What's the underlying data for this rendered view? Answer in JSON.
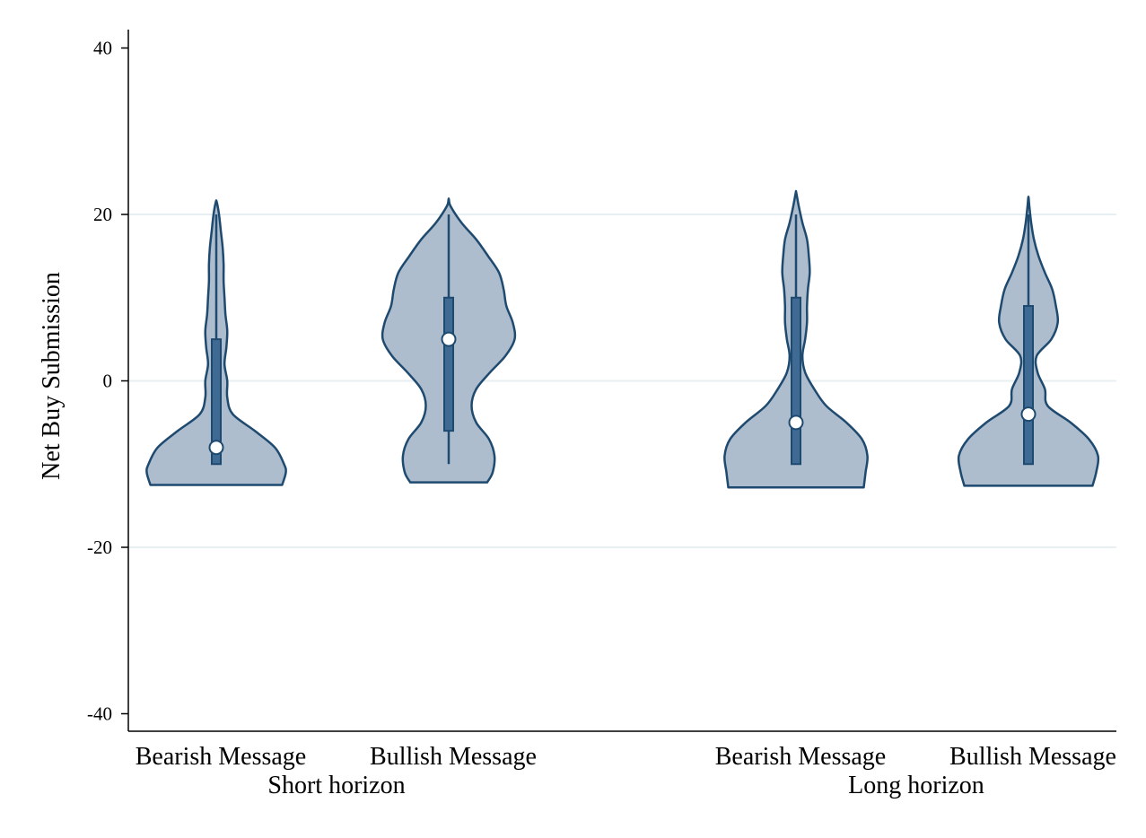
{
  "chart_data": {
    "type": "violin",
    "title": "",
    "ylabel": "Net Buy Submission",
    "xlabel": "",
    "ylim": [
      -40,
      40
    ],
    "yticks": [
      -40,
      -20,
      0,
      20,
      40
    ],
    "grid": true,
    "legend": "none",
    "groups": [
      "Short horizon",
      "Long horizon"
    ],
    "categories": [
      "Bearish Message",
      "Bullish Message",
      "Bearish Message",
      "Bullish Message"
    ],
    "series": [
      {
        "group": "Short horizon",
        "category": "Bearish Message",
        "min": -10,
        "q1": -10,
        "median": -8,
        "q3": 5,
        "max": 20,
        "density": [
          [
            -12.5,
            0.72
          ],
          [
            -11,
            0.76
          ],
          [
            -10,
            0.74
          ],
          [
            -8,
            0.64
          ],
          [
            -6,
            0.42
          ],
          [
            -4,
            0.18
          ],
          [
            -2,
            0.12
          ],
          [
            0,
            0.12
          ],
          [
            2,
            0.09
          ],
          [
            4,
            0.11
          ],
          [
            6,
            0.12
          ],
          [
            8,
            0.1
          ],
          [
            10,
            0.09
          ],
          [
            12,
            0.08
          ],
          [
            14,
            0.08
          ],
          [
            16,
            0.07
          ],
          [
            18,
            0.05
          ],
          [
            20,
            0.03
          ],
          [
            21.5,
            0.005
          ]
        ]
      },
      {
        "group": "Short horizon",
        "category": "Bullish Message",
        "min": -10,
        "q1": -6,
        "median": 5,
        "q3": 10,
        "max": 20,
        "density": [
          [
            -12.2,
            0.42
          ],
          [
            -11,
            0.48
          ],
          [
            -9,
            0.5
          ],
          [
            -7,
            0.44
          ],
          [
            -5,
            0.3
          ],
          [
            -3,
            0.25
          ],
          [
            -1,
            0.3
          ],
          [
            1,
            0.45
          ],
          [
            3,
            0.62
          ],
          [
            5,
            0.72
          ],
          [
            7,
            0.7
          ],
          [
            9,
            0.63
          ],
          [
            11,
            0.6
          ],
          [
            13,
            0.55
          ],
          [
            15,
            0.43
          ],
          [
            17,
            0.3
          ],
          [
            19,
            0.14
          ],
          [
            21,
            0.02
          ],
          [
            21.8,
            0.002
          ]
        ]
      },
      {
        "group": "Long horizon",
        "category": "Bearish Message",
        "min": -10,
        "q1": -10,
        "median": -5,
        "q3": 10,
        "max": 20,
        "density": [
          [
            -12.8,
            0.74
          ],
          [
            -11,
            0.76
          ],
          [
            -9,
            0.78
          ],
          [
            -7,
            0.72
          ],
          [
            -5,
            0.55
          ],
          [
            -3,
            0.33
          ],
          [
            -1,
            0.2
          ],
          [
            1,
            0.1
          ],
          [
            3,
            0.07
          ],
          [
            5,
            0.1
          ],
          [
            7,
            0.12
          ],
          [
            9,
            0.12
          ],
          [
            11,
            0.13
          ],
          [
            13,
            0.15
          ],
          [
            15,
            0.14
          ],
          [
            17,
            0.12
          ],
          [
            19,
            0.07
          ],
          [
            21,
            0.03
          ],
          [
            22.6,
            0.003
          ]
        ]
      },
      {
        "group": "Long horizon",
        "category": "Bullish Message",
        "min": -10,
        "q1": -10,
        "median": -4,
        "q3": 9,
        "max": 20,
        "density": [
          [
            -12.6,
            0.7
          ],
          [
            -11,
            0.74
          ],
          [
            -9,
            0.76
          ],
          [
            -7,
            0.66
          ],
          [
            -5,
            0.46
          ],
          [
            -3,
            0.21
          ],
          [
            -1,
            0.18
          ],
          [
            1,
            0.1
          ],
          [
            3,
            0.09
          ],
          [
            5,
            0.25
          ],
          [
            7,
            0.32
          ],
          [
            9,
            0.3
          ],
          [
            11,
            0.26
          ],
          [
            13,
            0.18
          ],
          [
            15,
            0.11
          ],
          [
            17,
            0.06
          ],
          [
            19,
            0.03
          ],
          [
            21,
            0.01
          ],
          [
            22,
            0.002
          ]
        ]
      }
    ],
    "colors": {
      "violin_fill": "#adbdcd",
      "violin_stroke": "#1f4a70",
      "box_fill": "#3f6a94",
      "box_stroke": "#1f4a70",
      "median_dot": "#ffffff",
      "grid": "#e7eff2",
      "axis": "#000000"
    }
  }
}
